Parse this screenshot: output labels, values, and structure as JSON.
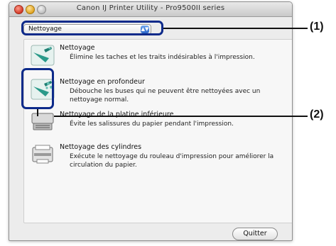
{
  "window": {
    "title": "Canon IJ Printer Utility - Pro9500II series"
  },
  "menu": {
    "selected": "Nettoyage"
  },
  "items": [
    {
      "title": "Nettoyage",
      "desc": "Élimine les taches et les traits indésirables à l'impression.",
      "icon": "cleaning-icon"
    },
    {
      "title": "Nettoyage en profondeur",
      "desc": "Débouche les buses qui ne peuvent être nettoyées avec un nettoyage normal.",
      "icon": "deep-cleaning-icon"
    },
    {
      "title": "Nettoyage de la platine inférieure",
      "desc": "Évite les salissures du papier pendant l'impression.",
      "icon": "bottom-plate-cleaning-icon"
    },
    {
      "title": "Nettoyage des cylindres",
      "desc": "Exécute le nettoyage du rouleau d'impression pour améliorer la circulation du papier.",
      "icon": "roller-cleaning-icon"
    }
  ],
  "buttons": {
    "quit": "Quitter"
  },
  "callouts": {
    "one": "(1)",
    "two": "(2)"
  },
  "colors": {
    "callout_border": "#0d2a8a",
    "icon_teal": "#2a9a8a"
  }
}
